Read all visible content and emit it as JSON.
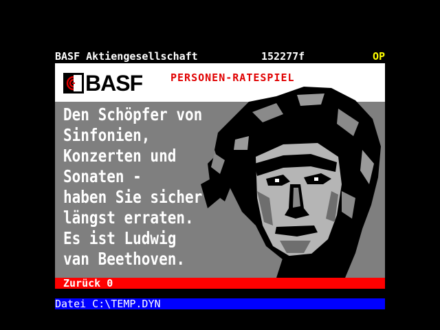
{
  "header": {
    "provider": "BASF Aktiengesellschaft",
    "page_number": "152277f",
    "status": "OP"
  },
  "logo": {
    "text": "BASF"
  },
  "title": "PERSONEN-RATESPIEL",
  "body_lines": [
    "Den Schöpfer von",
    "Sinfonien,",
    "Konzerten und",
    "Sonaten -",
    "haben Sie sicher",
    "längst erraten.",
    "Es ist Ludwig",
    "van Beethoven."
  ],
  "nav": {
    "back_label": "Zurück 0"
  },
  "file_bar": {
    "label": "Datei C:\\TEMP.DYN"
  },
  "colors": {
    "background": "#000000",
    "panel_gray": "#7f7f7f",
    "title_red": "#e00000",
    "nav_red": "#ff0000",
    "file_blue": "#0000ff",
    "status_yellow": "#ffff00"
  }
}
